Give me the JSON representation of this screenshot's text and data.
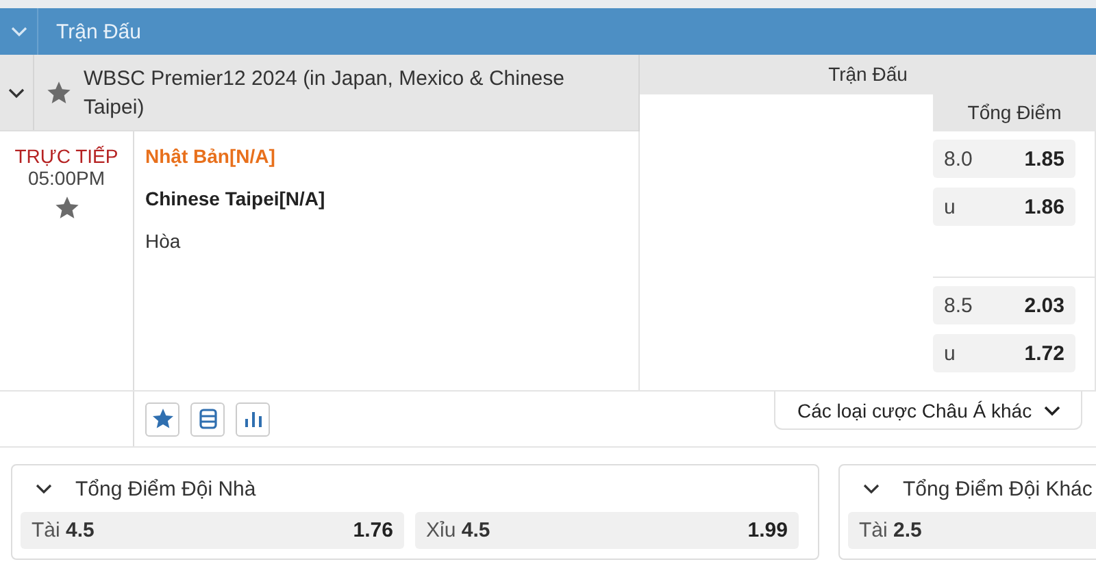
{
  "section_header": {
    "title": "Trận Đấu",
    "expanded": true
  },
  "league": {
    "name": "WBSC Premier12 2024 (in Japan, Mexico & Chinese Taipei)",
    "favorite": false,
    "expanded": true
  },
  "market_header": {
    "group": "Trận Đấu",
    "column": "Tổng Điểm"
  },
  "match": {
    "status": "TRỰC TIẾP",
    "time": "05:00PM",
    "favorite": false,
    "teams": [
      {
        "name": "Nhật Bản[N/A]",
        "kind": "favored"
      },
      {
        "name": "Chinese Taipei[N/A]",
        "kind": "normal"
      },
      {
        "name": "Hòa",
        "kind": "draw"
      }
    ]
  },
  "total_lines": [
    {
      "odds": [
        {
          "label": "8.0",
          "price": "1.85"
        },
        {
          "label": "u",
          "price": "1.86"
        }
      ]
    },
    {
      "odds": [
        {
          "label": "8.5",
          "price": "2.03"
        },
        {
          "label": "u",
          "price": "1.72"
        }
      ]
    }
  ],
  "more_bets": {
    "label": "Các loại cược Châu Á khác"
  },
  "cards": [
    {
      "title": "Tổng Điểm Đội Nhà",
      "expanded": true,
      "options": [
        {
          "label": "Tài",
          "line": "4.5",
          "price": "1.76"
        },
        {
          "label": "Xỉu",
          "line": "4.5",
          "price": "1.99"
        }
      ]
    },
    {
      "title": "Tổng Điểm Đội Khác",
      "expanded": true,
      "options": [
        {
          "label": "Tài",
          "line": "2.5"
        }
      ]
    }
  ]
}
